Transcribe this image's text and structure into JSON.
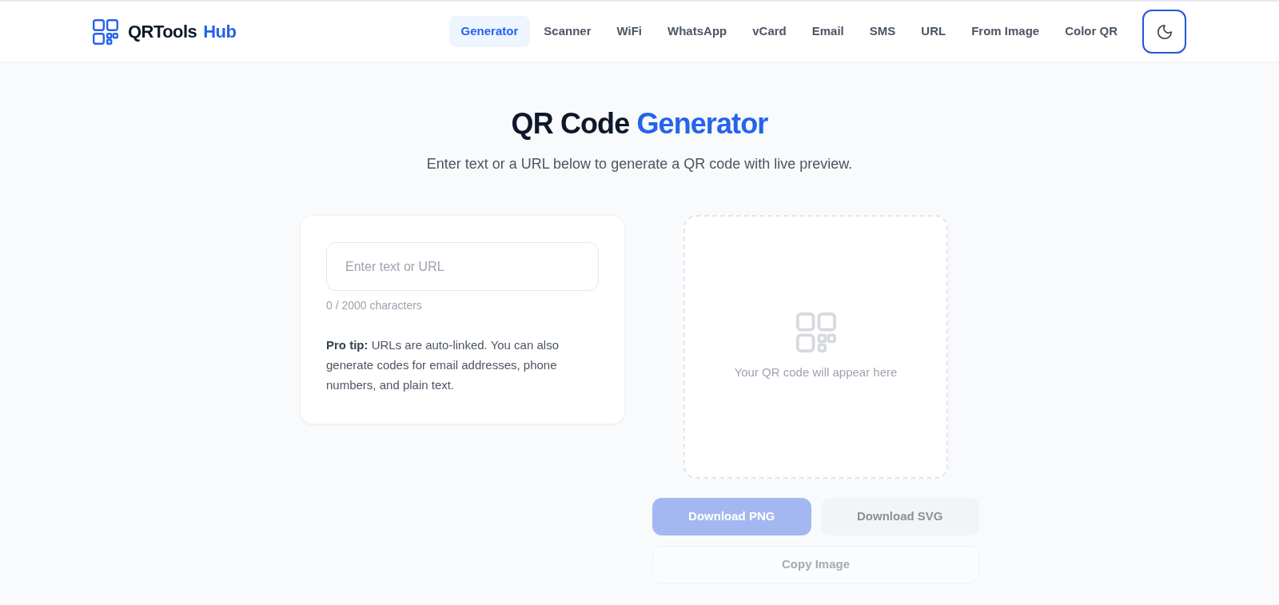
{
  "header": {
    "logo": {
      "name": "QRTools",
      "accent": "Hub"
    },
    "nav": [
      {
        "label": "Generator",
        "selected": true
      },
      {
        "label": "Scanner",
        "selected": false
      },
      {
        "label": "WiFi",
        "selected": false
      },
      {
        "label": "WhatsApp",
        "selected": false
      },
      {
        "label": "vCard",
        "selected": false
      },
      {
        "label": "Email",
        "selected": false
      },
      {
        "label": "SMS",
        "selected": false
      },
      {
        "label": "URL",
        "selected": false
      },
      {
        "label": "From Image",
        "selected": false
      },
      {
        "label": "Color QR",
        "selected": false
      }
    ],
    "theme_toggle": {
      "focused": true
    }
  },
  "hero": {
    "title": "QR Code",
    "title_accent": "Generator",
    "subtitle": "Enter text or a URL below to generate a QR code with live preview."
  },
  "input_card": {
    "input": {
      "placeholder": "Enter text or URL"
    },
    "counter": "0 / 2000 characters",
    "tip": "**Pro tip:** URLs are auto-linked. You can also generate codes for email addresses, phone numbers, and plain text."
  },
  "preview": {
    "empty_message": "Your QR code will appear here"
  },
  "actions": [
    {
      "label": "Download PNG",
      "kind": "primary",
      "disabled": true
    },
    {
      "label": "Download SVG",
      "kind": "secondary",
      "disabled": true
    },
    {
      "label": "Copy Image",
      "kind": "outline",
      "disabled": true
    }
  ]
}
